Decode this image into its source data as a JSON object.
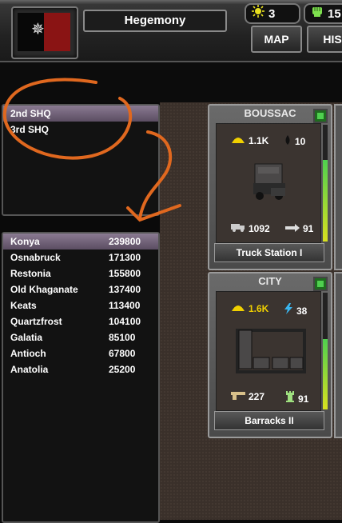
{
  "header": {
    "title": "Hegemony",
    "flag_icon": "hegemony-flag",
    "resource_a": {
      "icon": "sun-icon",
      "value": "3"
    },
    "resource_b": {
      "icon": "fist-icon",
      "value": "15"
    },
    "nav": {
      "map_label": "MAP",
      "his_label": "HIS"
    }
  },
  "hq_list": {
    "items": [
      {
        "label": "2nd SHQ",
        "selected": true
      },
      {
        "label": "3rd SHQ",
        "selected": false
      }
    ]
  },
  "city_list": {
    "items": [
      {
        "name": "Konya",
        "value": "239800",
        "selected": true
      },
      {
        "name": "Osnabruck",
        "value": "171300"
      },
      {
        "name": "Restonia",
        "value": "155800"
      },
      {
        "name": "Old Khaganate",
        "value": "137400"
      },
      {
        "name": "Keats",
        "value": "113400"
      },
      {
        "name": "Quartzfrost",
        "value": "104100"
      },
      {
        "name": "Galatia",
        "value": "85100"
      },
      {
        "name": "Antioch",
        "value": "67800"
      },
      {
        "name": "Anatolia",
        "value": "25200"
      }
    ]
  },
  "buildings": [
    {
      "location": "BOUSSAC",
      "stat1_icon": "helmet-icon",
      "stat1": "1.1K",
      "stat2_icon": "drop-icon",
      "stat2": "10",
      "stat3_icon": "truck-icon",
      "stat3": "1092",
      "stat4_icon": "arrow-icon",
      "stat4": "91",
      "name": "Truck Station I",
      "status_color": "#4fd04f"
    },
    {
      "location": "CITY",
      "stat1_icon": "helmet-icon",
      "stat1": "1.6K",
      "stat2_icon": "lightning-icon",
      "stat2": "38",
      "stat3_icon": "gun-icon",
      "stat3": "227",
      "stat4_icon": "tower-icon",
      "stat4": "91",
      "name": "Barracks II",
      "status_color": "#4fd04f"
    }
  ],
  "colors": {
    "accent_annotation": "#e0681f",
    "selected_row": "#6f6178",
    "helmet": "#f0d000",
    "lightning": "#39b6f0"
  }
}
